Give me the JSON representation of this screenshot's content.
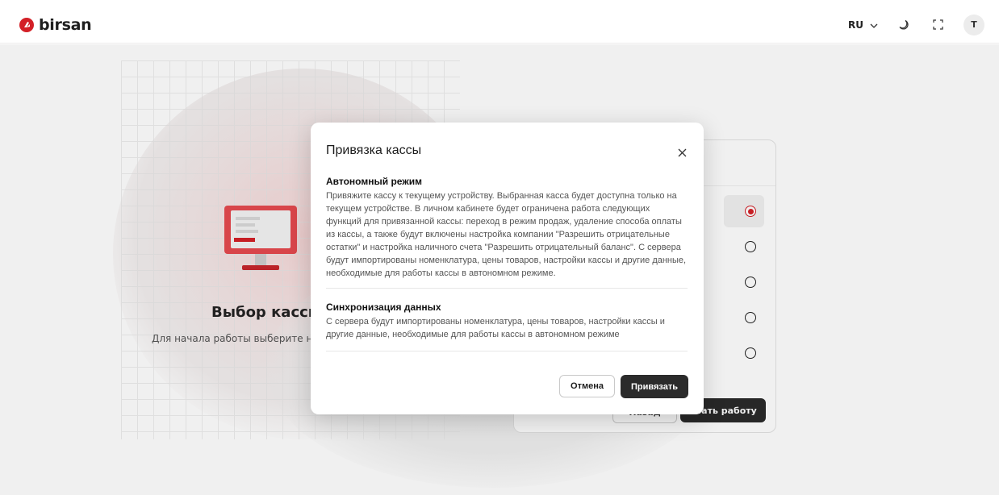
{
  "header": {
    "logo_text": "birsan",
    "language": "RU",
    "avatar_initial": "T"
  },
  "background": {
    "title": "Выбор кассы",
    "subtitle": "Для начала работы выберите ну",
    "card": {
      "radios": [
        {
          "selected": true
        },
        {
          "selected": false
        },
        {
          "selected": false
        },
        {
          "selected": false
        },
        {
          "selected": false
        }
      ],
      "back_label": "Назад",
      "start_label": "ачать работу"
    }
  },
  "modal": {
    "title": "Привязка кассы",
    "sections": [
      {
        "title": "Автономный режим",
        "text": "Привяжите кассу к текущему устройству. Выбранная касса будет доступна только на текущем устройстве. В личном кабинете будет ограничена работа следующих функций для привязанной кассы: переход в режим продаж, удаление способа оплаты из кассы, а также будут включены настройка компании \"Разрешить отрицательные остатки\" и настройка наличного счета \"Разрешить отрицательный баланс\". С сервера будут импортированы номенклатура, цены товаров, настройки кассы и другие данные, необходимые для работы кассы в автономном режиме."
      },
      {
        "title": "Синхронизация данных",
        "text": "С сервера будут импортированы номенклатура, цены товаров, настройки кассы и другие данные, необходимые для работы кассы в автономном режиме"
      }
    ],
    "cancel_label": "Отмена",
    "bind_label": "Привязать"
  },
  "colors": {
    "brand": "#d32027",
    "primary_button": "#2b2b2b"
  }
}
